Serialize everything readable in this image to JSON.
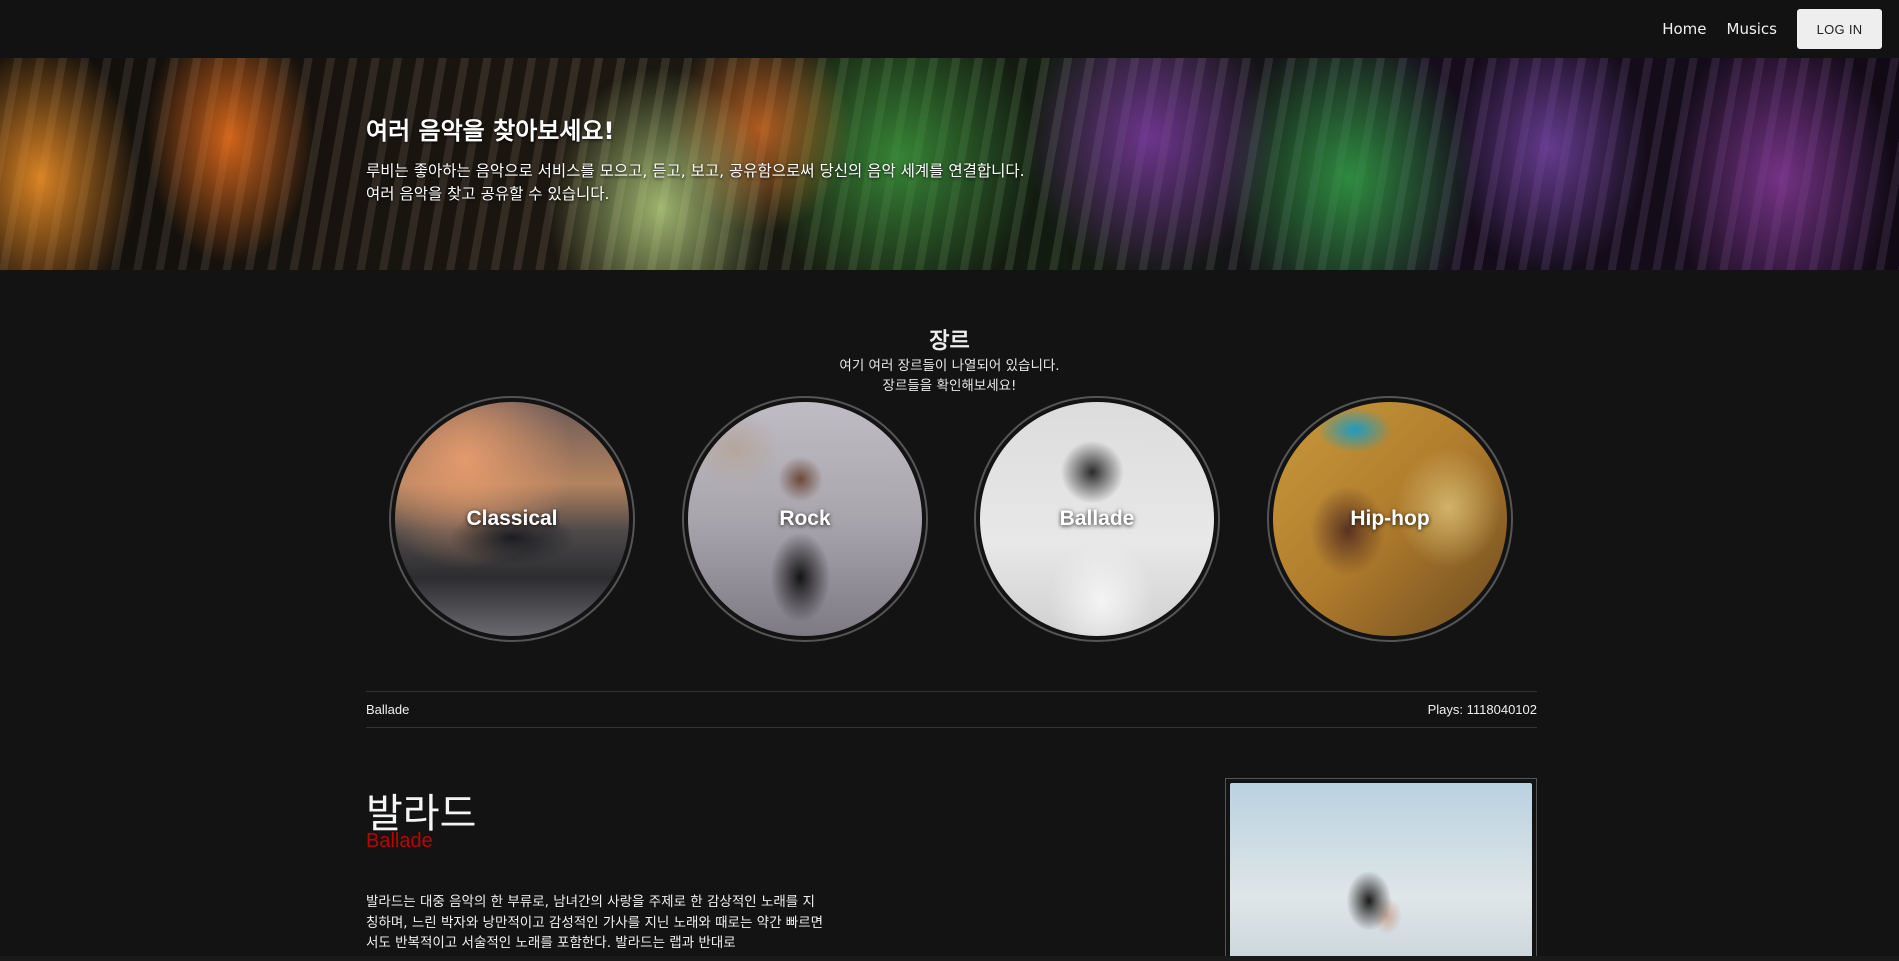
{
  "nav": {
    "links": [
      "Home",
      "Musics"
    ],
    "login_label": "LOG IN"
  },
  "hero": {
    "title": "여러 음악을 찾아보세요!",
    "desc_line1": "루비는 좋아하는 음악으로 서비스를 모으고, 듣고, 보고, 공유함으로써 당신의 음악 세계를 연결합니다.",
    "desc_line2": "여러 음악을 찾고 공유할 수 있습니다."
  },
  "genre": {
    "title": "장르",
    "sub_line1": "여기 여러 장르들이 나열되어 있습니다.",
    "sub_line2": "장르들을 확인해보세요!",
    "items": [
      {
        "label": "Classical"
      },
      {
        "label": "Rock"
      },
      {
        "label": "Ballade"
      },
      {
        "label": "Hip-hop"
      }
    ]
  },
  "selected": {
    "genre": "Ballade",
    "plays": "Plays: 1118040102"
  },
  "detail": {
    "title": "발라드",
    "subtitle": "Ballade",
    "description": "발라드는 대중 음악의 한 부류로, 남녀간의 사랑을 주제로 한 감상적인 노래를 지칭하며, 느린 박자와 낭만적이고 감성적인 가사를 지닌 노래와 때로는 약간 빠르면서도 반복적이고 서술적인 노래를 포함한다. 발라드는 랩과 반대로"
  }
}
